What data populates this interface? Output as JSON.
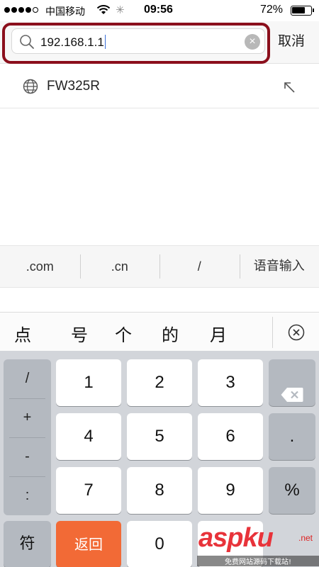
{
  "status_bar": {
    "carrier": "中国移动",
    "time": "09:56",
    "battery_percent": "72%",
    "battery_level": 0.72,
    "signal_bars_filled": 4,
    "signal_bars_total": 5
  },
  "search": {
    "value": "192.168.1.1",
    "cancel_label": "取消",
    "highlight_color": "#8b0f1c"
  },
  "suggestion": {
    "label": "FW325R",
    "icon": "globe-icon",
    "action_icon": "arrow-up-left-icon"
  },
  "shortcuts": [
    ".com",
    ".cn",
    "/",
    "语音输入"
  ],
  "candidates": [
    "点",
    "号",
    "个",
    "的",
    "月"
  ],
  "keyboard": {
    "side_symbols": [
      "/",
      "+",
      "-",
      ":"
    ],
    "digits": [
      "1",
      "2",
      "3",
      "4",
      "5",
      "6",
      "7",
      "8",
      "9",
      "0"
    ],
    "dot": ".",
    "percent": "%",
    "fu_label": "符",
    "back_label": "返回",
    "accent_color": "#f26a36"
  },
  "watermark": {
    "logo": "aspku",
    "domain": ".net",
    "subtitle": "免费网站源码下载站!"
  }
}
